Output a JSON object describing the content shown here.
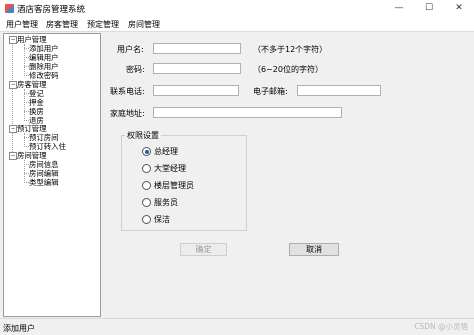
{
  "window": {
    "title": "酒店客房管理系统",
    "minimize": "—",
    "maximize": "☐",
    "close": "✕"
  },
  "menu": [
    "用户管理",
    "房客管理",
    "预定管理",
    "房间管理"
  ],
  "tree": [
    {
      "label": "用户管理",
      "expanded": true,
      "children": [
        "添加用户",
        "编辑用户",
        "删除用户",
        "修改密码"
      ]
    },
    {
      "label": "房客管理",
      "expanded": true,
      "children": [
        "登记",
        "押金",
        "换房",
        "退房"
      ]
    },
    {
      "label": "预订管理",
      "expanded": true,
      "children": [
        "预订房间",
        "预订转入住"
      ]
    },
    {
      "label": "房间管理",
      "expanded": true,
      "children": [
        "房间信息",
        "房间编辑",
        "类型编辑"
      ]
    }
  ],
  "form": {
    "username_label": "用户名:",
    "username_value": "",
    "username_hint": "（不多于12个字符）",
    "password_label": "密码:",
    "password_value": "",
    "password_hint": "（6~20位的字符）",
    "phone_label": "联系电话:",
    "phone_value": "",
    "email_label": "电子邮箱:",
    "email_value": "",
    "address_label": "家庭地址:",
    "address_value": "",
    "permission_title": "权限设置",
    "roles": [
      "总经理",
      "大堂经理",
      "楼层管理员",
      "服务员",
      "保洁"
    ],
    "selected_role": "总经理",
    "confirm_label": "确定",
    "cancel_label": "取消"
  },
  "status": {
    "text": "添加用户"
  },
  "watermark": "CSDN @小灵悟"
}
